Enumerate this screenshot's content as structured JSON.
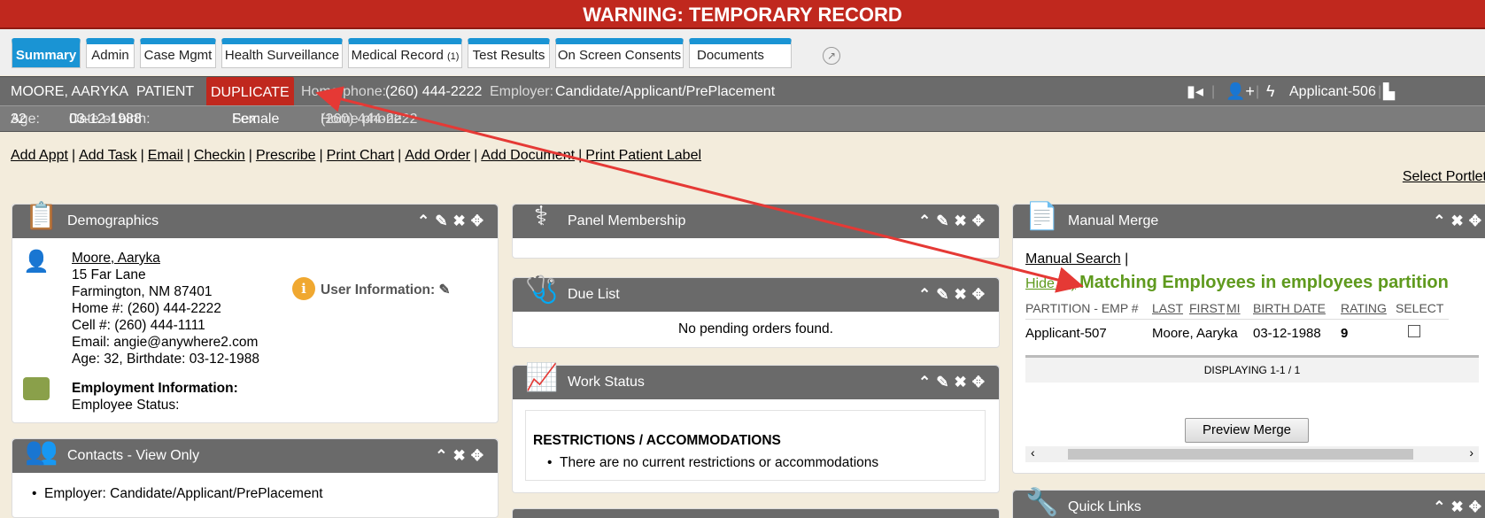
{
  "warning": "WARNING: TEMPORARY RECORD",
  "tabs": [
    {
      "label": "Summary"
    },
    {
      "label": "Admin"
    },
    {
      "label": "Case Mgmt"
    },
    {
      "label": "Health Surveillance"
    },
    {
      "label": "Medical Record",
      "badge": "(1)"
    },
    {
      "label": "Test Results"
    },
    {
      "label": "On Screen Consents"
    },
    {
      "label": "Documents"
    }
  ],
  "patient": {
    "name": "MOORE, AARYKA",
    "type": "PATIENT",
    "flag": "DUPLICATE",
    "home_phone_label": "Home phone:",
    "home_phone": "(260) 444-2222",
    "employer_label": "Employer:",
    "employer": "Candidate/Applicant/PrePlacement",
    "applicant_id": "Applicant-506",
    "age_label": "Age:",
    "age": "32",
    "dob_label": "Date of birth:",
    "dob": "03-12-1988",
    "sex_label": "Sex:",
    "sex": "Female"
  },
  "actions": [
    "Add Appt",
    "Add Task",
    "Email",
    "Checkin",
    "Prescribe",
    "Print Chart",
    "Add Order",
    "Add Document",
    "Print Patient Label"
  ],
  "select_portlets": "Select Portlets",
  "demographics": {
    "title": "Demographics",
    "name": "Moore, Aaryka",
    "address1": "15 Far Lane",
    "address2": "Farmington, NM 87401",
    "home": "Home #: (260) 444-2222",
    "cell": "Cell #: (260) 444-1111",
    "email": "Email: angie@anywhere2.com",
    "age": "Age: 32, Birthdate: 03-12-1988",
    "user_info": "User Information:",
    "employment_title": "Employment Information:",
    "employee_status": "Employee Status:"
  },
  "contacts": {
    "title": "Contacts - View Only",
    "item": "Employer: Candidate/Applicant/PrePlacement"
  },
  "panel_membership": {
    "title": "Panel Membership"
  },
  "due_list": {
    "title": "Due List",
    "empty": "No pending orders found."
  },
  "work_status": {
    "title": "Work Status",
    "heading": "RESTRICTIONS / ACCOMMODATIONS",
    "item": "There are no current restrictions or accommodations"
  },
  "manual_merge": {
    "title": "Manual Merge",
    "search_link": "Manual Search",
    "hide_link": "Hide (1)",
    "heading": "Matching Employees in employees partition",
    "columns": [
      "PARTITION - EMP #",
      "LAST",
      "FIRST",
      "MI",
      "BIRTH DATE",
      "RATING",
      "SELECT"
    ],
    "row": {
      "partition": "Applicant-507",
      "name": "Moore, Aaryka",
      "birth_date": "03-12-1988",
      "rating": "9"
    },
    "displaying": "DISPLAYING 1-1 / 1",
    "preview_button": "Preview Merge"
  },
  "quick_links": {
    "title": "Quick Links"
  },
  "colors": {
    "warning": "#c0281e",
    "tab_accent": "#1a94d4",
    "panel_header": "#6a6a6a",
    "merge_heading": "#5f9a1e",
    "annotation_arrow": "#e53935"
  }
}
